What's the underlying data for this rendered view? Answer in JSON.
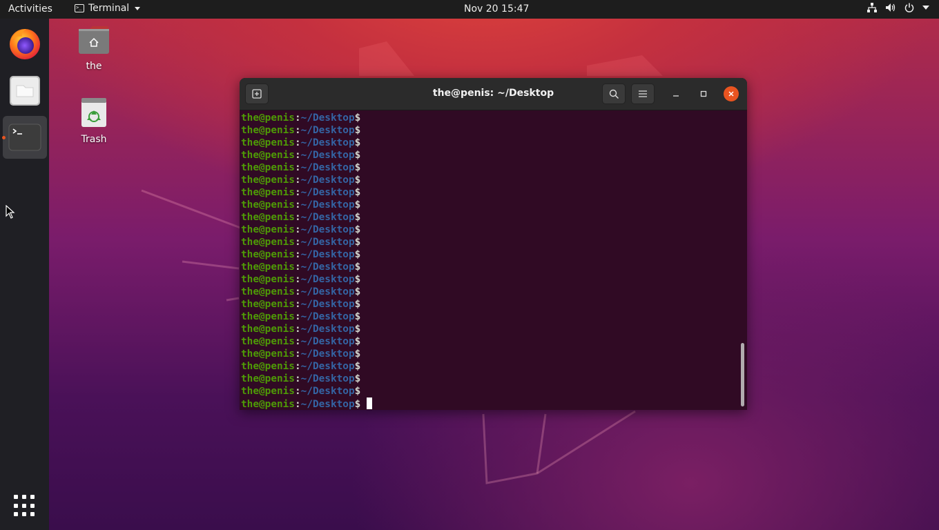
{
  "topbar": {
    "activities": "Activities",
    "app_name": "Terminal",
    "clock": "Nov 20  15:47",
    "tray_icons": [
      "network-icon",
      "volume-icon",
      "power-icon",
      "system-menu-caret"
    ]
  },
  "dock": {
    "items": [
      {
        "name": "Firefox",
        "icon": "firefox-icon"
      },
      {
        "name": "Files",
        "icon": "files-icon"
      },
      {
        "name": "Terminal",
        "icon": "terminal-icon",
        "active": true
      }
    ],
    "show_apps_icon": "apps-grid-icon"
  },
  "desktop": {
    "icons": [
      {
        "label": "the",
        "icon": "home-folder-icon"
      },
      {
        "label": "Trash",
        "icon": "trash-icon"
      }
    ]
  },
  "terminal": {
    "title": "the@penis: ~/Desktop",
    "prompt_user": "the@penis",
    "prompt_colon": ":",
    "prompt_path": "~/Desktop",
    "prompt_symbol": "$",
    "prompt_line_count": 24
  },
  "colors": {
    "accent": "#e95420",
    "prompt_user": "#4e9a06",
    "prompt_path": "#3465a4",
    "terminal_bg": "#300a24"
  }
}
